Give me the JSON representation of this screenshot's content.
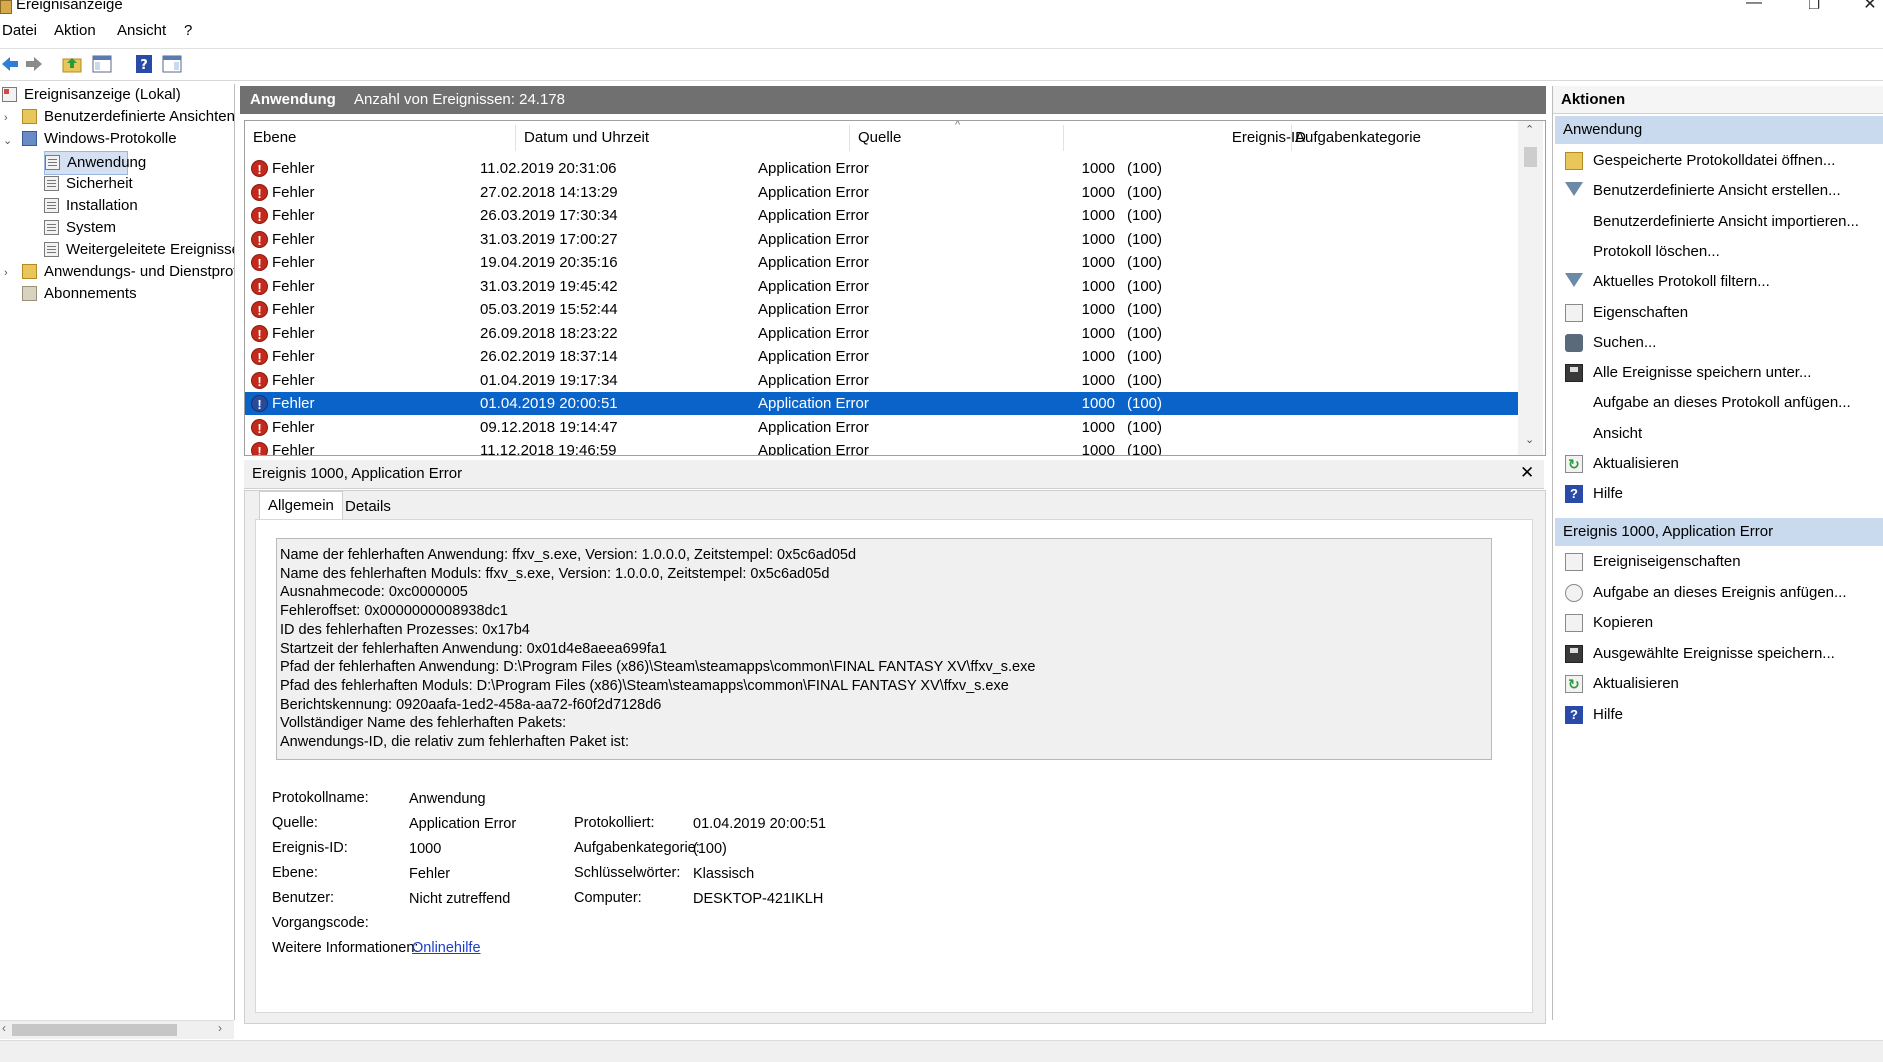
{
  "window": {
    "title": "Ereignisanzeige",
    "minimize": "—",
    "restore": "❐",
    "close": "✕"
  },
  "menu": [
    "Datei",
    "Aktion",
    "Ansicht",
    "?"
  ],
  "toolbar_icons": [
    "back-arrow-icon",
    "forward-arrow-icon",
    "up-folder-icon",
    "show-hide-tree-icon",
    "help-icon",
    "show-hide-action-pane-icon"
  ],
  "tree": {
    "root": "Ereignisanzeige (Lokal)",
    "custom_views": "Benutzerdefinierte Ansichten",
    "windows_logs": "Windows-Protokolle",
    "windows_logs_items": [
      "Anwendung",
      "Sicherheit",
      "Installation",
      "System",
      "Weitergeleitete Ereignisse"
    ],
    "app_service_logs": "Anwendungs- und Dienstprotokolle",
    "subscriptions": "Abonnements"
  },
  "center_header": {
    "title": "Anwendung",
    "count": "Anzahl von Ereignissen: 24.178"
  },
  "list": {
    "columns": [
      "Ebene",
      "Datum und Uhrzeit",
      "Quelle",
      "Ereignis-ID",
      "Aufgabenkategorie"
    ],
    "sort_indicator": "^",
    "rows": [
      {
        "level": "Fehler",
        "date": "11.02.2019 20:31:06",
        "source": "Application Error",
        "id": "1000",
        "category": "(100)"
      },
      {
        "level": "Fehler",
        "date": "27.02.2018 14:13:29",
        "source": "Application Error",
        "id": "1000",
        "category": "(100)"
      },
      {
        "level": "Fehler",
        "date": "26.03.2019 17:30:34",
        "source": "Application Error",
        "id": "1000",
        "category": "(100)"
      },
      {
        "level": "Fehler",
        "date": "31.03.2019 17:00:27",
        "source": "Application Error",
        "id": "1000",
        "category": "(100)"
      },
      {
        "level": "Fehler",
        "date": "19.04.2019 20:35:16",
        "source": "Application Error",
        "id": "1000",
        "category": "(100)"
      },
      {
        "level": "Fehler",
        "date": "31.03.2019 19:45:42",
        "source": "Application Error",
        "id": "1000",
        "category": "(100)"
      },
      {
        "level": "Fehler",
        "date": "05.03.2019 15:52:44",
        "source": "Application Error",
        "id": "1000",
        "category": "(100)"
      },
      {
        "level": "Fehler",
        "date": "26.09.2018 18:23:22",
        "source": "Application Error",
        "id": "1000",
        "category": "(100)"
      },
      {
        "level": "Fehler",
        "date": "26.02.2019 18:37:14",
        "source": "Application Error",
        "id": "1000",
        "category": "(100)"
      },
      {
        "level": "Fehler",
        "date": "01.04.2019 19:17:34",
        "source": "Application Error",
        "id": "1000",
        "category": "(100)"
      },
      {
        "level": "Fehler",
        "date": "01.04.2019 20:00:51",
        "source": "Application Error",
        "id": "1000",
        "category": "(100)",
        "selected": true
      },
      {
        "level": "Fehler",
        "date": "09.12.2018 19:14:47",
        "source": "Application Error",
        "id": "1000",
        "category": "(100)"
      },
      {
        "level": "Fehler",
        "date": "11.12.2018 19:46:59",
        "source": "Application Error",
        "id": "1000",
        "category": "(100)"
      }
    ]
  },
  "detail": {
    "title": "Ereignis 1000, Application Error",
    "close": "✕",
    "tabs": [
      "Allgemein",
      "Details"
    ],
    "description": [
      "Name der fehlerhaften Anwendung: ffxv_s.exe, Version: 1.0.0.0, Zeitstempel: 0x5c6ad05d",
      "Name des fehlerhaften Moduls: ffxv_s.exe, Version: 1.0.0.0, Zeitstempel: 0x5c6ad05d",
      "Ausnahmecode: 0xc0000005",
      "Fehleroffset: 0x0000000008938dc1",
      "ID des fehlerhaften Prozesses: 0x17b4",
      "Startzeit der fehlerhaften Anwendung: 0x01d4e8aeea699fa1",
      "Pfad der fehlerhaften Anwendung: D:\\Program Files (x86)\\Steam\\steamapps\\common\\FINAL FANTASY XV\\ffxv_s.exe",
      "Pfad des fehlerhaften Moduls: D:\\Program Files (x86)\\Steam\\steamapps\\common\\FINAL FANTASY XV\\ffxv_s.exe",
      "Berichtskennung: 0920aafa-1ed2-458a-aa72-f60f2d7128d6",
      "Vollständiger Name des fehlerhaften Pakets:",
      "Anwendungs-ID, die relativ zum fehlerhaften Paket ist:"
    ],
    "props": {
      "protokollname_label": "Protokollname:",
      "protokollname": "Anwendung",
      "quelle_label": "Quelle:",
      "quelle": "Application Error",
      "protokolliert_label": "Protokolliert:",
      "protokolliert": "01.04.2019 20:00:51",
      "ereignis_id_label": "Ereignis-ID:",
      "ereignis_id": "1000",
      "aufgabenkategorie_label": "Aufgabenkategorie:",
      "aufgabenkategorie": "(100)",
      "ebene_label": "Ebene:",
      "ebene": "Fehler",
      "schluesselwoerter_label": "Schlüsselwörter:",
      "schluesselwoerter": "Klassisch",
      "benutzer_label": "Benutzer:",
      "benutzer": "Nicht zutreffend",
      "computer_label": "Computer:",
      "computer": "DESKTOP-421IKLH",
      "vorgangscode_label": "Vorgangscode:",
      "weitere_label": "Weitere Informationen:",
      "weitere_link": "Onlinehilfe"
    }
  },
  "actions": {
    "title": "Aktionen",
    "section1": "Anwendung",
    "section1_items": [
      {
        "label": "Gespeicherte Protokolldatei öffnen...",
        "icon": "open-folder-icon"
      },
      {
        "label": "Benutzerdefinierte Ansicht erstellen...",
        "icon": "filter-icon"
      },
      {
        "label": "Benutzerdefinierte Ansicht importieren...",
        "icon": ""
      },
      {
        "label": "Protokoll löschen...",
        "icon": ""
      },
      {
        "label": "Aktuelles Protokoll filtern...",
        "icon": "filter-icon"
      },
      {
        "label": "Eigenschaften",
        "icon": "properties-icon"
      },
      {
        "label": "Suchen...",
        "icon": "binoculars-icon"
      },
      {
        "label": "Alle Ereignisse speichern unter...",
        "icon": "save-icon"
      },
      {
        "label": "Aufgabe an dieses Protokoll anfügen...",
        "icon": ""
      },
      {
        "label": "Ansicht",
        "icon": ""
      },
      {
        "label": "Aktualisieren",
        "icon": "refresh-icon"
      },
      {
        "label": "Hilfe",
        "icon": "help-icon"
      }
    ],
    "section2": "Ereignis 1000, Application Error",
    "section2_items": [
      {
        "label": "Ereigniseigenschaften",
        "icon": "properties-icon"
      },
      {
        "label": "Aufgabe an dieses Ereignis anfügen...",
        "icon": "task-icon"
      },
      {
        "label": "Kopieren",
        "icon": "copy-icon"
      },
      {
        "label": "Ausgewählte Ereignisse speichern...",
        "icon": "save-icon"
      },
      {
        "label": "Aktualisieren",
        "icon": "refresh-icon"
      },
      {
        "label": "Hilfe",
        "icon": "help-icon"
      }
    ]
  },
  "colors": {
    "selection": "#0a63c9",
    "header_bar": "#707070",
    "action_section": "#c9d9ee",
    "error_icon": "#c42a1c"
  }
}
